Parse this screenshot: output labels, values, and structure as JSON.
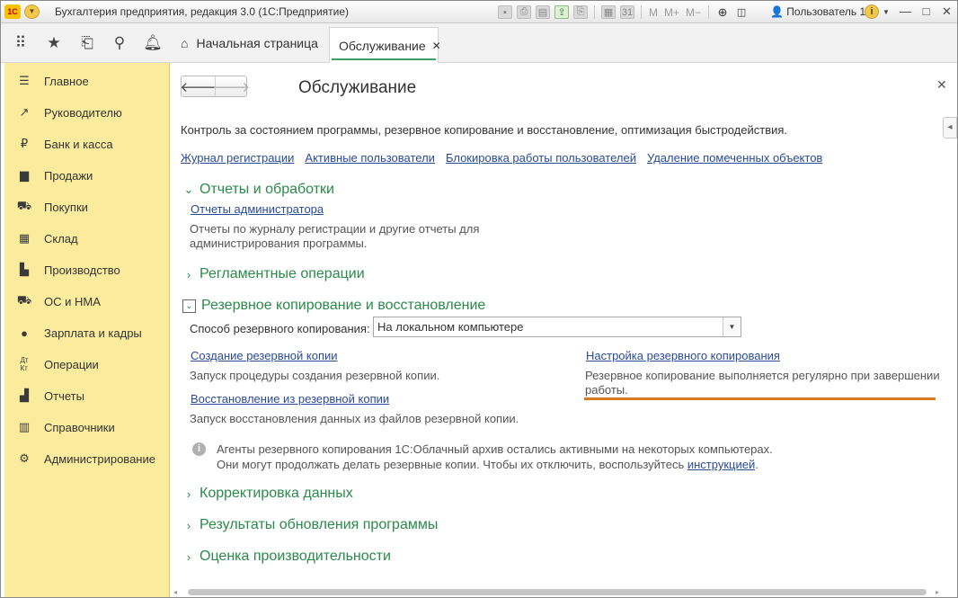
{
  "window": {
    "title": "Бухгалтерия предприятия, редакция 3.0  (1С:Предприятие)",
    "logo": "1С",
    "user": "Пользователь 1",
    "toolbar_memory": [
      "M",
      "M+",
      "M−"
    ]
  },
  "tabs": {
    "home": "Начальная страница",
    "active": "Обслуживание"
  },
  "sidebar": {
    "items": [
      {
        "label": "Главное",
        "icon": "menu-icon"
      },
      {
        "label": "Руководителю",
        "icon": "trend-icon"
      },
      {
        "label": "Банк и касса",
        "icon": "ruble-icon"
      },
      {
        "label": "Продажи",
        "icon": "bag-icon"
      },
      {
        "label": "Покупки",
        "icon": "cart-icon"
      },
      {
        "label": "Склад",
        "icon": "warehouse-icon"
      },
      {
        "label": "Производство",
        "icon": "factory-icon"
      },
      {
        "label": "ОС и НМА",
        "icon": "truck-icon"
      },
      {
        "label": "Зарплата и кадры",
        "icon": "person-icon"
      },
      {
        "label": "Операции",
        "icon": "dt-kt-icon"
      },
      {
        "label": "Отчеты",
        "icon": "bar-chart-icon"
      },
      {
        "label": "Справочники",
        "icon": "book-icon"
      },
      {
        "label": "Администрирование",
        "icon": "gear-icon"
      }
    ]
  },
  "form": {
    "title": "Обслуживание",
    "description": "Контроль за состоянием программы, резервное копирование и восстановление, оптимизация быстродействия.",
    "top_links": [
      "Журнал регистрации",
      "Активные пользователи",
      "Блокировка работы пользователей",
      "Удаление помеченных объектов"
    ],
    "sections": {
      "reports": {
        "title": "Отчеты и обработки",
        "link": "Отчеты администратора",
        "text_line1": "Отчеты по журналу регистрации и другие отчеты для",
        "text_line2": "администрирования программы."
      },
      "routine": {
        "title": "Регламентные операции"
      },
      "backup": {
        "title": "Резервное копирование и восстановление",
        "method_label": "Способ резервного копирования:",
        "method_value": "На локальном компьютере",
        "create_link": "Создание резервной копии",
        "create_text": "Запуск процедуры создания резервной копии.",
        "restore_link": "Восстановление из резервной копии",
        "restore_text": "Запуск восстановления данных из файлов резервной копии.",
        "settings_link": "Настройка резервного копирования",
        "settings_text_line1": "Резервное копирование выполняется регулярно при завершении",
        "settings_text_line2": "работы.",
        "note_line1": "Агенты резервного копирования 1С:Облачный архив остались активными на некоторых компьютерах.",
        "note_line2_prefix": "Они могут продолжать делать резервные копии. Чтобы их отключить, воспользуйтесь ",
        "note_link": "инструкцией",
        "note_line2_suffix": "."
      },
      "correction": {
        "title": "Корректировка данных"
      },
      "update_results": {
        "title": "Результаты обновления программы"
      },
      "performance": {
        "title": "Оценка производительности"
      }
    }
  },
  "colors": {
    "sidebar_bg": "#fbec9d",
    "section_green": "#2a8a4a",
    "link_blue": "#2a4a9a",
    "accent_orange": "#d77c21",
    "tab_underline": "#3ca063"
  }
}
